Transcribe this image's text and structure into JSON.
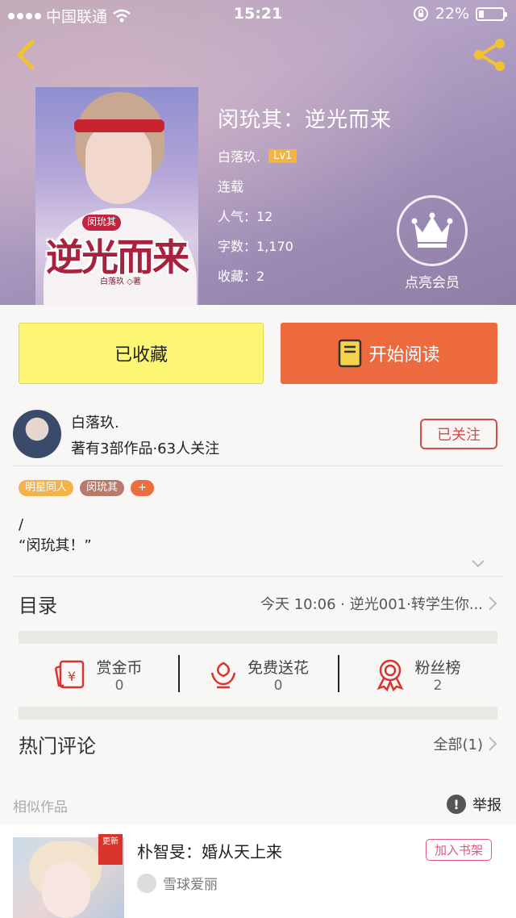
{
  "status_bar": {
    "carrier": "中国联通",
    "time": "15:21",
    "battery": "22%"
  },
  "book": {
    "title": "闵玧其：逆光而来",
    "author": "白落玖.",
    "level": "Lv1",
    "status": "连载",
    "popularity": "人气：12",
    "word_count": "字数：1,170",
    "favorites": "收藏：2",
    "cover_title": "逆光而来",
    "cover_tag": "闵玧其",
    "cover_author": "白落玖 ◇著"
  },
  "vip": {
    "label": "点亮会员"
  },
  "actions": {
    "favorite_label": "已收藏",
    "read_label": "开始阅读"
  },
  "author_card": {
    "name": "白落玖.",
    "stats": "著有3部作品·63人关注",
    "follow_label": "已关注"
  },
  "tags": [
    "明星同人",
    "闵玧其",
    "+"
  ],
  "description": {
    "line1": "/",
    "line2": "“闵玧其！”"
  },
  "catalog": {
    "label": "目录",
    "latest": "今天 10:06 · 逆光001·转学生你..."
  },
  "stats": [
    {
      "label": "赏金币",
      "value": "0",
      "icon": "reward-coin-icon"
    },
    {
      "label": "免费送花",
      "value": "0",
      "icon": "flower-icon"
    },
    {
      "label": "粉丝榜",
      "value": "2",
      "icon": "medal-icon"
    }
  ],
  "comments": {
    "label": "热门评论",
    "all": "全部(1)"
  },
  "similar": {
    "label": "相似作品",
    "report": "举报"
  },
  "recommend": {
    "title": "朴智旻：婚从天上来",
    "author": "雪球爱丽",
    "badge": "更新",
    "add_label": "加入书架"
  },
  "colors": {
    "accent_orange": "#ec6a3d",
    "fav_yellow": "#fdf674",
    "follow_red": "#d64a4a",
    "level_gold": "#f6b43e"
  }
}
